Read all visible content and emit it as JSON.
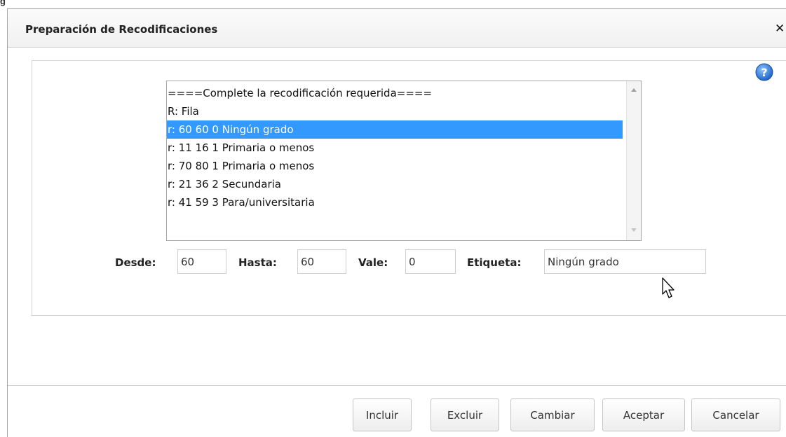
{
  "page_fragment": "g",
  "dialog": {
    "title": "Preparación de Recodificaciones",
    "close_symbol": "✕",
    "help_symbol": "?"
  },
  "list": {
    "items": [
      {
        "text": "====Complete la recodificación requerida====",
        "selected": false
      },
      {
        "text": "R: Fila",
        "selected": false
      },
      {
        "text": "r: 60 60 0 Ningún grado",
        "selected": true
      },
      {
        "text": "r: 11 16 1 Primaria o menos",
        "selected": false
      },
      {
        "text": "r: 70 80 1 Primaria o menos",
        "selected": false
      },
      {
        "text": "r: 21 36 2 Secundaria",
        "selected": false
      },
      {
        "text": "r: 41 59 3 Para/universitaria",
        "selected": false
      }
    ]
  },
  "fields": {
    "desde_label": "Desde:",
    "desde_value": "60",
    "hasta_label": "Hasta:",
    "hasta_value": "60",
    "vale_label": "Vale:",
    "vale_value": "0",
    "etiqueta_label": "Etiqueta:",
    "etiqueta_value": "Ningún grado"
  },
  "buttons": {
    "incluir": "Incluir",
    "excluir": "Excluir",
    "cambiar": "Cambiar",
    "aceptar": "Aceptar",
    "cancelar": "Cancelar"
  },
  "colors": {
    "selection": "#3399ff",
    "help_icon": "#2f7fd6"
  }
}
